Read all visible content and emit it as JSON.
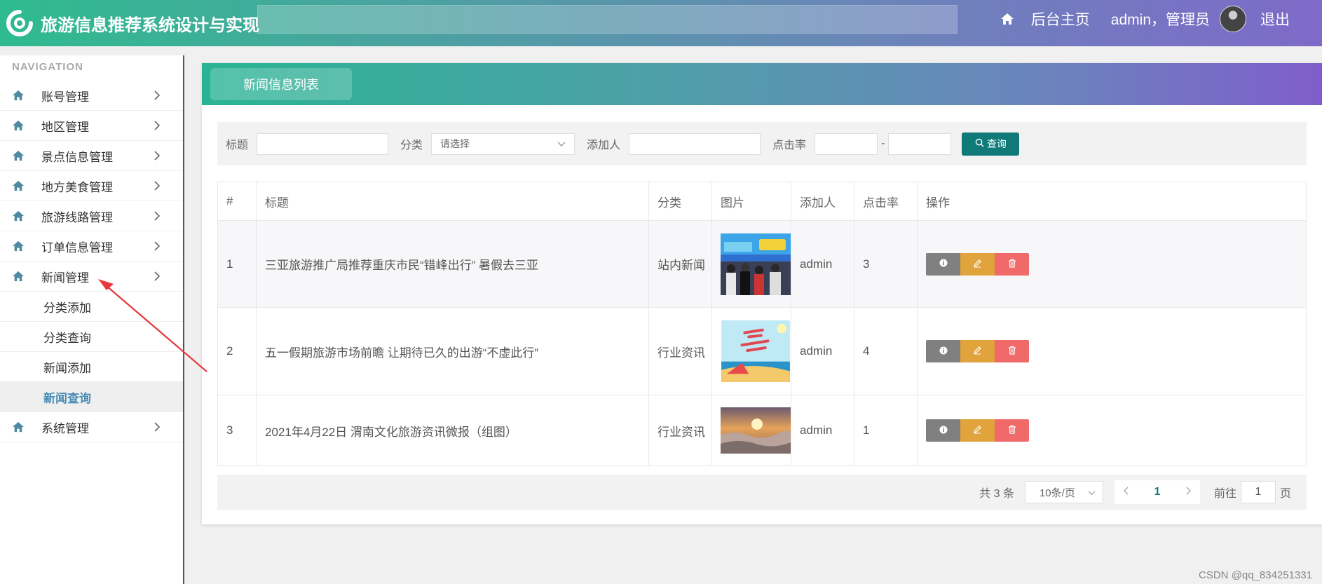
{
  "header": {
    "title": "旅游信息推荐系统设计与实现",
    "home_label": "后台主页",
    "user_label": "admin，管理员",
    "logout_label": "退出",
    "logo_icon": "logo-ring-icon",
    "home_icon": "home-icon"
  },
  "sidebar": {
    "heading": "NAVIGATION",
    "items": [
      {
        "label": "账号管理"
      },
      {
        "label": "地区管理"
      },
      {
        "label": "景点信息管理"
      },
      {
        "label": "地方美食管理"
      },
      {
        "label": "旅游线路管理"
      },
      {
        "label": "订单信息管理"
      },
      {
        "label": "新闻管理",
        "expanded": true
      },
      {
        "label": "系统管理"
      }
    ],
    "news_submenu": [
      {
        "label": "分类添加"
      },
      {
        "label": "分类查询"
      },
      {
        "label": "新闻添加"
      },
      {
        "label": "新闻查询",
        "active": true
      }
    ]
  },
  "card": {
    "tab_title": "新闻信息列表"
  },
  "search": {
    "title_label": "标题",
    "category_label": "分类",
    "category_placeholder": "请选择",
    "adder_label": "添加人",
    "clicks_label": "点击率",
    "range_sep": "-",
    "query_button": "查询"
  },
  "table": {
    "headers": [
      "#",
      "标题",
      "分类",
      "图片",
      "添加人",
      "点击率",
      "操作"
    ],
    "rows": [
      {
        "no": "1",
        "title": "三亚旅游推广局推荐重庆市民“错峰出行” 暑假去三亚",
        "category": "站内新闻",
        "image": "conference-event-photo",
        "adder": "admin",
        "clicks": "3"
      },
      {
        "no": "2",
        "title": "五一假期旅游市场前瞻 让期待已久的出游“不虚此行”",
        "category": "行业资讯",
        "image": "may-day-beach-poster",
        "adder": "admin",
        "clicks": "4"
      },
      {
        "no": "3",
        "title": "2021年4月22日 渭南文化旅游资讯微报（组图）",
        "category": "行业资讯",
        "image": "sunset-sea-of-clouds-photo",
        "adder": "admin",
        "clicks": "1"
      }
    ]
  },
  "pagination": {
    "total": "共 3 条",
    "page_size": "10条/页",
    "current_page": "1",
    "goto_label": "前往",
    "goto_value": "1",
    "page_unit": "页"
  },
  "watermark": "CSDN @qq_834251331",
  "colors": {
    "header_start": "#2fbb8f",
    "header_end": "#7e6ac9",
    "accent": "#107a79",
    "info_button": "#808080",
    "edit_button": "#e1a33c",
    "delete_button": "#f06a6a",
    "annotation_arrow": "#e8383d"
  }
}
